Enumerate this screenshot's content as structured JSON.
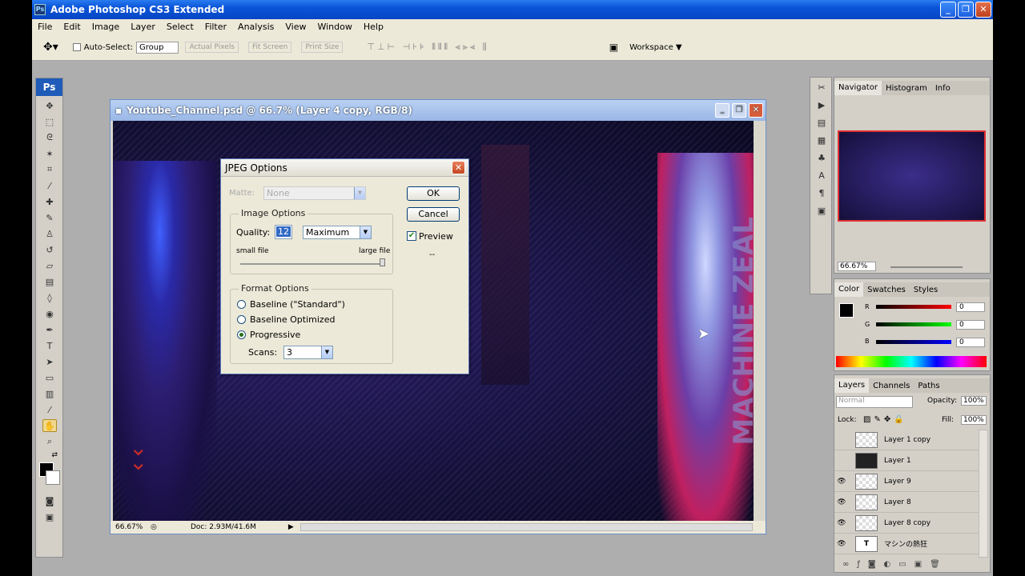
{
  "app": {
    "title": "Adobe Photoshop CS3 Extended",
    "badge": "Ps"
  },
  "menu": [
    "File",
    "Edit",
    "Image",
    "Layer",
    "Select",
    "Filter",
    "Analysis",
    "View",
    "Window",
    "Help"
  ],
  "options": {
    "auto_select": "Auto-Select:",
    "group": "Group",
    "actual_pixels": "Actual Pixels",
    "fit_screen": "Fit Screen",
    "print_size": "Print Size",
    "workspace": "Workspace ▼"
  },
  "document": {
    "title": "Youtube_Channel.psd @ 66.7% (Layer 4 copy, RGB/8)",
    "zoom": "66.67%",
    "doc_size": "Doc: 2.93M/41.6M"
  },
  "dialog": {
    "title": "JPEG Options",
    "matte_label": "Matte:",
    "matte_value": "None",
    "ok": "OK",
    "cancel": "Cancel",
    "preview": "Preview",
    "image_options": "Image Options",
    "quality_label": "Quality:",
    "quality_value": "12",
    "quality_preset": "Maximum",
    "small_file": "small file",
    "large_file": "large file",
    "size_readout": "--",
    "format_options": "Format Options",
    "baseline_standard": "Baseline (\"Standard\")",
    "baseline_optimized": "Baseline Optimized",
    "progressive": "Progressive",
    "scans_label": "Scans:",
    "scans_value": "3"
  },
  "navigator": {
    "tabs": [
      "Navigator",
      "Histogram",
      "Info"
    ],
    "zoom": "66.67%"
  },
  "color": {
    "tabs": [
      "Color",
      "Swatches",
      "Styles"
    ],
    "r_label": "R",
    "g_label": "G",
    "b_label": "B",
    "r": "0",
    "g": "0",
    "b": "0"
  },
  "layers": {
    "tabs": [
      "Layers",
      "Channels",
      "Paths"
    ],
    "blend": "Normal",
    "opacity_label": "Opacity:",
    "opacity": "100%",
    "lock_label": "Lock:",
    "fill_label": "Fill:",
    "fill": "100%",
    "items": [
      {
        "name": "Layer 1 copy"
      },
      {
        "name": "Layer 1"
      },
      {
        "name": "Layer 9"
      },
      {
        "name": "Layer 8"
      },
      {
        "name": "Layer 8 copy"
      },
      {
        "name": "マシンの熱狂"
      }
    ]
  },
  "colors": {
    "accent": "#0a54d8",
    "panel": "#d4d0c8"
  }
}
